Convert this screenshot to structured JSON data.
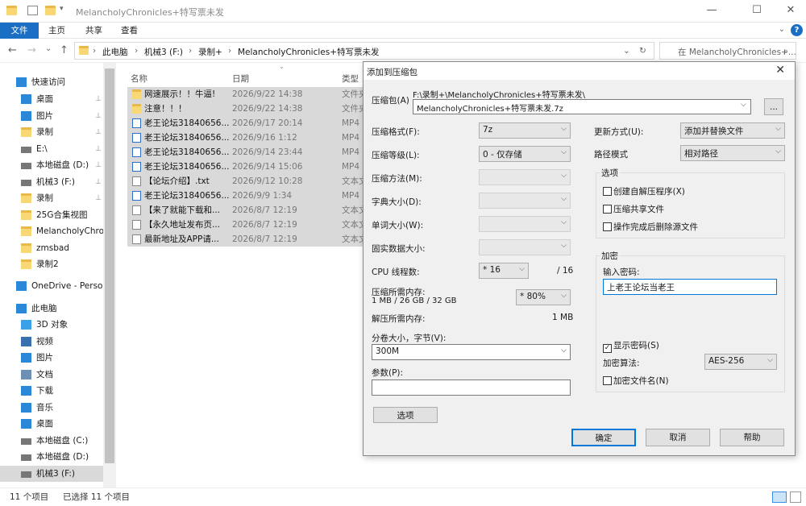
{
  "window": {
    "title": "MelancholyChronicles+特写票未发",
    "minimize": "—",
    "maximize": "☐",
    "close": "✕"
  },
  "ribbon": {
    "tabs": [
      "文件",
      "主页",
      "共享",
      "查看"
    ],
    "help": "?"
  },
  "nav": {
    "back": "←",
    "forward": "→",
    "recent": "⌄",
    "up": "↑",
    "refresh": "↻",
    "dropdown": "⌄"
  },
  "address": {
    "parts": [
      "此电脑",
      "机械3 (F:)",
      "录制+",
      "MelancholyChronicles+特写票未发"
    ],
    "sep": "›"
  },
  "search": {
    "placeholder": "在 MelancholyChronicles+..."
  },
  "sidebar": {
    "items": [
      {
        "label": "快速访问",
        "icon": "star-icon",
        "color": "#2b88d8"
      },
      {
        "label": "桌面",
        "icon": "desktop-icon",
        "color": "#2b88d8",
        "pinned": true
      },
      {
        "label": "图片",
        "icon": "pictures-icon",
        "color": "#2b88d8",
        "pinned": true
      },
      {
        "label": "录制",
        "icon": "folder-icon",
        "color": "#f8d775",
        "pinned": true
      },
      {
        "label": "E:\\",
        "icon": "drive-icon",
        "color": "#777777",
        "pinned": true
      },
      {
        "label": "本地磁盘 (D:)",
        "icon": "drive-icon",
        "color": "#777777",
        "pinned": true
      },
      {
        "label": "机械3 (F:)",
        "icon": "drive-icon",
        "color": "#777777",
        "pinned": true
      },
      {
        "label": "录制",
        "icon": "folder-icon",
        "color": "#f8d775",
        "pinned": true
      },
      {
        "label": "25G合集视图",
        "icon": "folder-icon",
        "color": "#f8d775"
      },
      {
        "label": "MelancholyChronicles",
        "icon": "folder-icon",
        "color": "#f8d775"
      },
      {
        "label": "zmsbad",
        "icon": "folder-icon",
        "color": "#f8d775"
      },
      {
        "label": "录制2",
        "icon": "folder-icon",
        "color": "#f8d775"
      },
      {
        "label": "OneDrive - Personal",
        "icon": "cloud-icon",
        "color": "#2b88d8"
      },
      {
        "label": "此电脑",
        "icon": "computer-icon",
        "color": "#2b88d8"
      },
      {
        "label": "3D 对象",
        "icon": "cube-icon",
        "color": "#3aa0e8"
      },
      {
        "label": "视频",
        "icon": "video-icon",
        "color": "#3a6fb0"
      },
      {
        "label": "图片",
        "icon": "pictures-icon",
        "color": "#2b88d8"
      },
      {
        "label": "文档",
        "icon": "document-icon",
        "color": "#6d8fb4"
      },
      {
        "label": "下载",
        "icon": "download-icon",
        "color": "#2b88d8"
      },
      {
        "label": "音乐",
        "icon": "music-icon",
        "color": "#2b88d8"
      },
      {
        "label": "桌面",
        "icon": "desktop-icon",
        "color": "#2b88d8"
      },
      {
        "label": "本地磁盘 (C:)",
        "icon": "drive-icon",
        "color": "#777777"
      },
      {
        "label": "本地磁盘 (D:)",
        "icon": "drive-icon",
        "color": "#777777"
      },
      {
        "label": "机械3 (F:)",
        "icon": "drive-icon",
        "color": "#777777",
        "selected": true
      }
    ],
    "pin_glyph": "📌"
  },
  "filelist": {
    "headers": {
      "name": "名称",
      "date": "日期",
      "type": "类型"
    },
    "rows": [
      {
        "name": "网速展示！！牛逼!",
        "date": "2026/9/22 14:38",
        "type": "文件夹",
        "icon": "folder-icon"
      },
      {
        "name": "注意！！！",
        "date": "2026/9/22 14:38",
        "type": "文件夹",
        "icon": "folder-icon"
      },
      {
        "name": "老王论坛31840656...",
        "date": "2026/9/17 20:14",
        "type": "MP4",
        "icon": "video-file-icon"
      },
      {
        "name": "老王论坛31840656...",
        "date": "2026/9/16 1:12",
        "type": "MP4",
        "icon": "video-file-icon"
      },
      {
        "name": "老王论坛31840656...",
        "date": "2026/9/14 23:44",
        "type": "MP4",
        "icon": "video-file-icon"
      },
      {
        "name": "老王论坛31840656...",
        "date": "2026/9/14 15:06",
        "type": "MP4",
        "icon": "video-file-icon"
      },
      {
        "name": "【论坛介绍】.txt",
        "date": "2026/9/12 10:28",
        "type": "文本文",
        "icon": "text-file-icon"
      },
      {
        "name": "老王论坛31840656...",
        "date": "2026/9/9 1:34",
        "type": "MP4",
        "icon": "video-file-icon"
      },
      {
        "name": "【来了就能下载和...",
        "date": "2026/8/7 12:19",
        "type": "文本文",
        "icon": "text-file-icon"
      },
      {
        "name": "【永久地址发布页...",
        "date": "2026/8/7 12:19",
        "type": "文本文",
        "icon": "text-file-icon"
      },
      {
        "name": "最新地址及APP请...",
        "date": "2026/8/7 12:19",
        "type": "文本文",
        "icon": "text-file-icon"
      }
    ]
  },
  "status": {
    "count": "11 个项目",
    "selected": "已选择 11 个项目"
  },
  "dialog": {
    "title": "添加到压缩包",
    "close": "✕",
    "archive_label": "压缩包(A)",
    "archive_path": "F:\\录制+\\MelancholyChronicles+特写票未发\\",
    "archive_name": "MelancholyChronicles+特写票未发.7z",
    "browse": "...",
    "format_label": "压缩格式(F):",
    "format_value": "7z",
    "level_label": "压缩等级(L):",
    "level_value": "0 - 仅存储",
    "method_label": "压缩方法(M):",
    "dict_label": "字典大小(D):",
    "word_label": "单词大小(W):",
    "solid_label": "固实数据大小:",
    "threads_label": "CPU 线程数:",
    "threads_value": "* 16",
    "threads_max": "/ 16",
    "mem_label": "压缩所需内存:",
    "mem_values": "1 MB / 26 GB / 32 GB",
    "mem_percent": "* 80%",
    "decomp_label": "解压所需内存:",
    "decomp_value": "1 MB",
    "volume_label": "分卷大小，字节(V):",
    "volume_value": "300M",
    "params_label": "参数(P):",
    "params_value": "",
    "options_button": "选项",
    "update_label": "更新方式(U):",
    "update_value": "添加并替换文件",
    "pathmode_label": "路径模式",
    "pathmode_value": "相对路径",
    "options_group": "选项",
    "opt_sfx": "创建自解压程序(X)",
    "opt_shared": "压缩共享文件",
    "opt_delete": "操作完成后删除源文件",
    "enc_group": "加密",
    "pwd_label": "输入密码:",
    "pwd_value": "上老王论坛当老王",
    "show_pwd": "显示密码(S)",
    "check_mark": "✓",
    "enc_method_label": "加密算法:",
    "enc_method_value": "AES-256",
    "enc_names": "加密文件名(N)",
    "ok": "确定",
    "cancel": "取消",
    "help": "帮助",
    "dropdown_glyph": "⌵"
  }
}
